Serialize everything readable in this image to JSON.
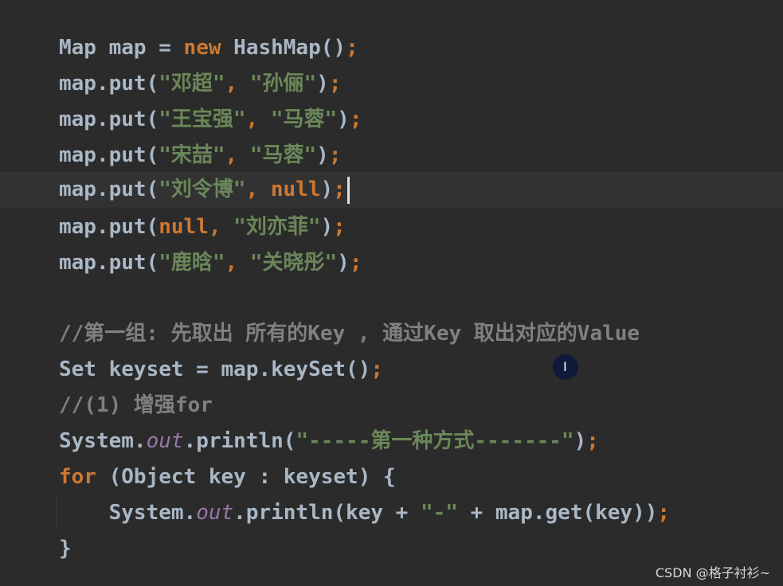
{
  "editor": {
    "colors": {
      "background": "#2b2b2b",
      "default_text": "#a9b7c6",
      "keyword": "#cc7832",
      "string": "#6a8759",
      "comment": "#808080",
      "static_field": "#9876aa",
      "current_line": "#323232"
    },
    "lines": [
      {
        "id": "l1",
        "tokens": [
          "Map map = ",
          "new",
          " HashMap()",
          ";"
        ]
      },
      {
        "id": "l2",
        "tokens": [
          "map.put(",
          "\"邓超\"",
          ", ",
          "\"孙俪\"",
          ")",
          ";"
        ]
      },
      {
        "id": "l3",
        "tokens": [
          "map.put(",
          "\"王宝强\"",
          ", ",
          "\"马蓉\"",
          ")",
          ";"
        ]
      },
      {
        "id": "l4",
        "tokens": [
          "map.put(",
          "\"宋喆\"",
          ", ",
          "\"马蓉\"",
          ")",
          ";"
        ]
      },
      {
        "id": "l5",
        "tokens": [
          "map.put(",
          "\"刘令博\"",
          ", ",
          "null",
          ")",
          ";"
        ]
      },
      {
        "id": "l6",
        "tokens": [
          "map.put(",
          "null",
          ", ",
          "\"刘亦菲\"",
          ")",
          ";"
        ]
      },
      {
        "id": "l7",
        "tokens": [
          "map.put(",
          "\"鹿晗\"",
          ", ",
          "\"关晓彤\"",
          ")",
          ";"
        ]
      },
      {
        "id": "l8",
        "tokens": [
          "//第一组: 先取出 所有的Key , 通过Key 取出对应的Value"
        ]
      },
      {
        "id": "l9",
        "tokens": [
          "Set keyset = map.keySet()",
          ";"
        ]
      },
      {
        "id": "l10",
        "tokens": [
          "//(1) 增强for"
        ]
      },
      {
        "id": "l11",
        "tokens": [
          "System.",
          "out",
          ".println(",
          "\"-----第一种方式-------\"",
          ")",
          ";"
        ]
      },
      {
        "id": "l12",
        "tokens": [
          "for",
          " (Object key : keyset) {"
        ]
      },
      {
        "id": "l13",
        "tokens": [
          "    System.",
          "out",
          ".println(key + ",
          "\"-\"",
          " + map.get(key))",
          ";"
        ]
      },
      {
        "id": "l14",
        "tokens": [
          "}"
        ]
      }
    ]
  },
  "mouse_cursor": {
    "icon": "ibeam-cursor-icon",
    "glyph": "I"
  },
  "watermark": {
    "text": "CSDN @格子衬衫~"
  }
}
